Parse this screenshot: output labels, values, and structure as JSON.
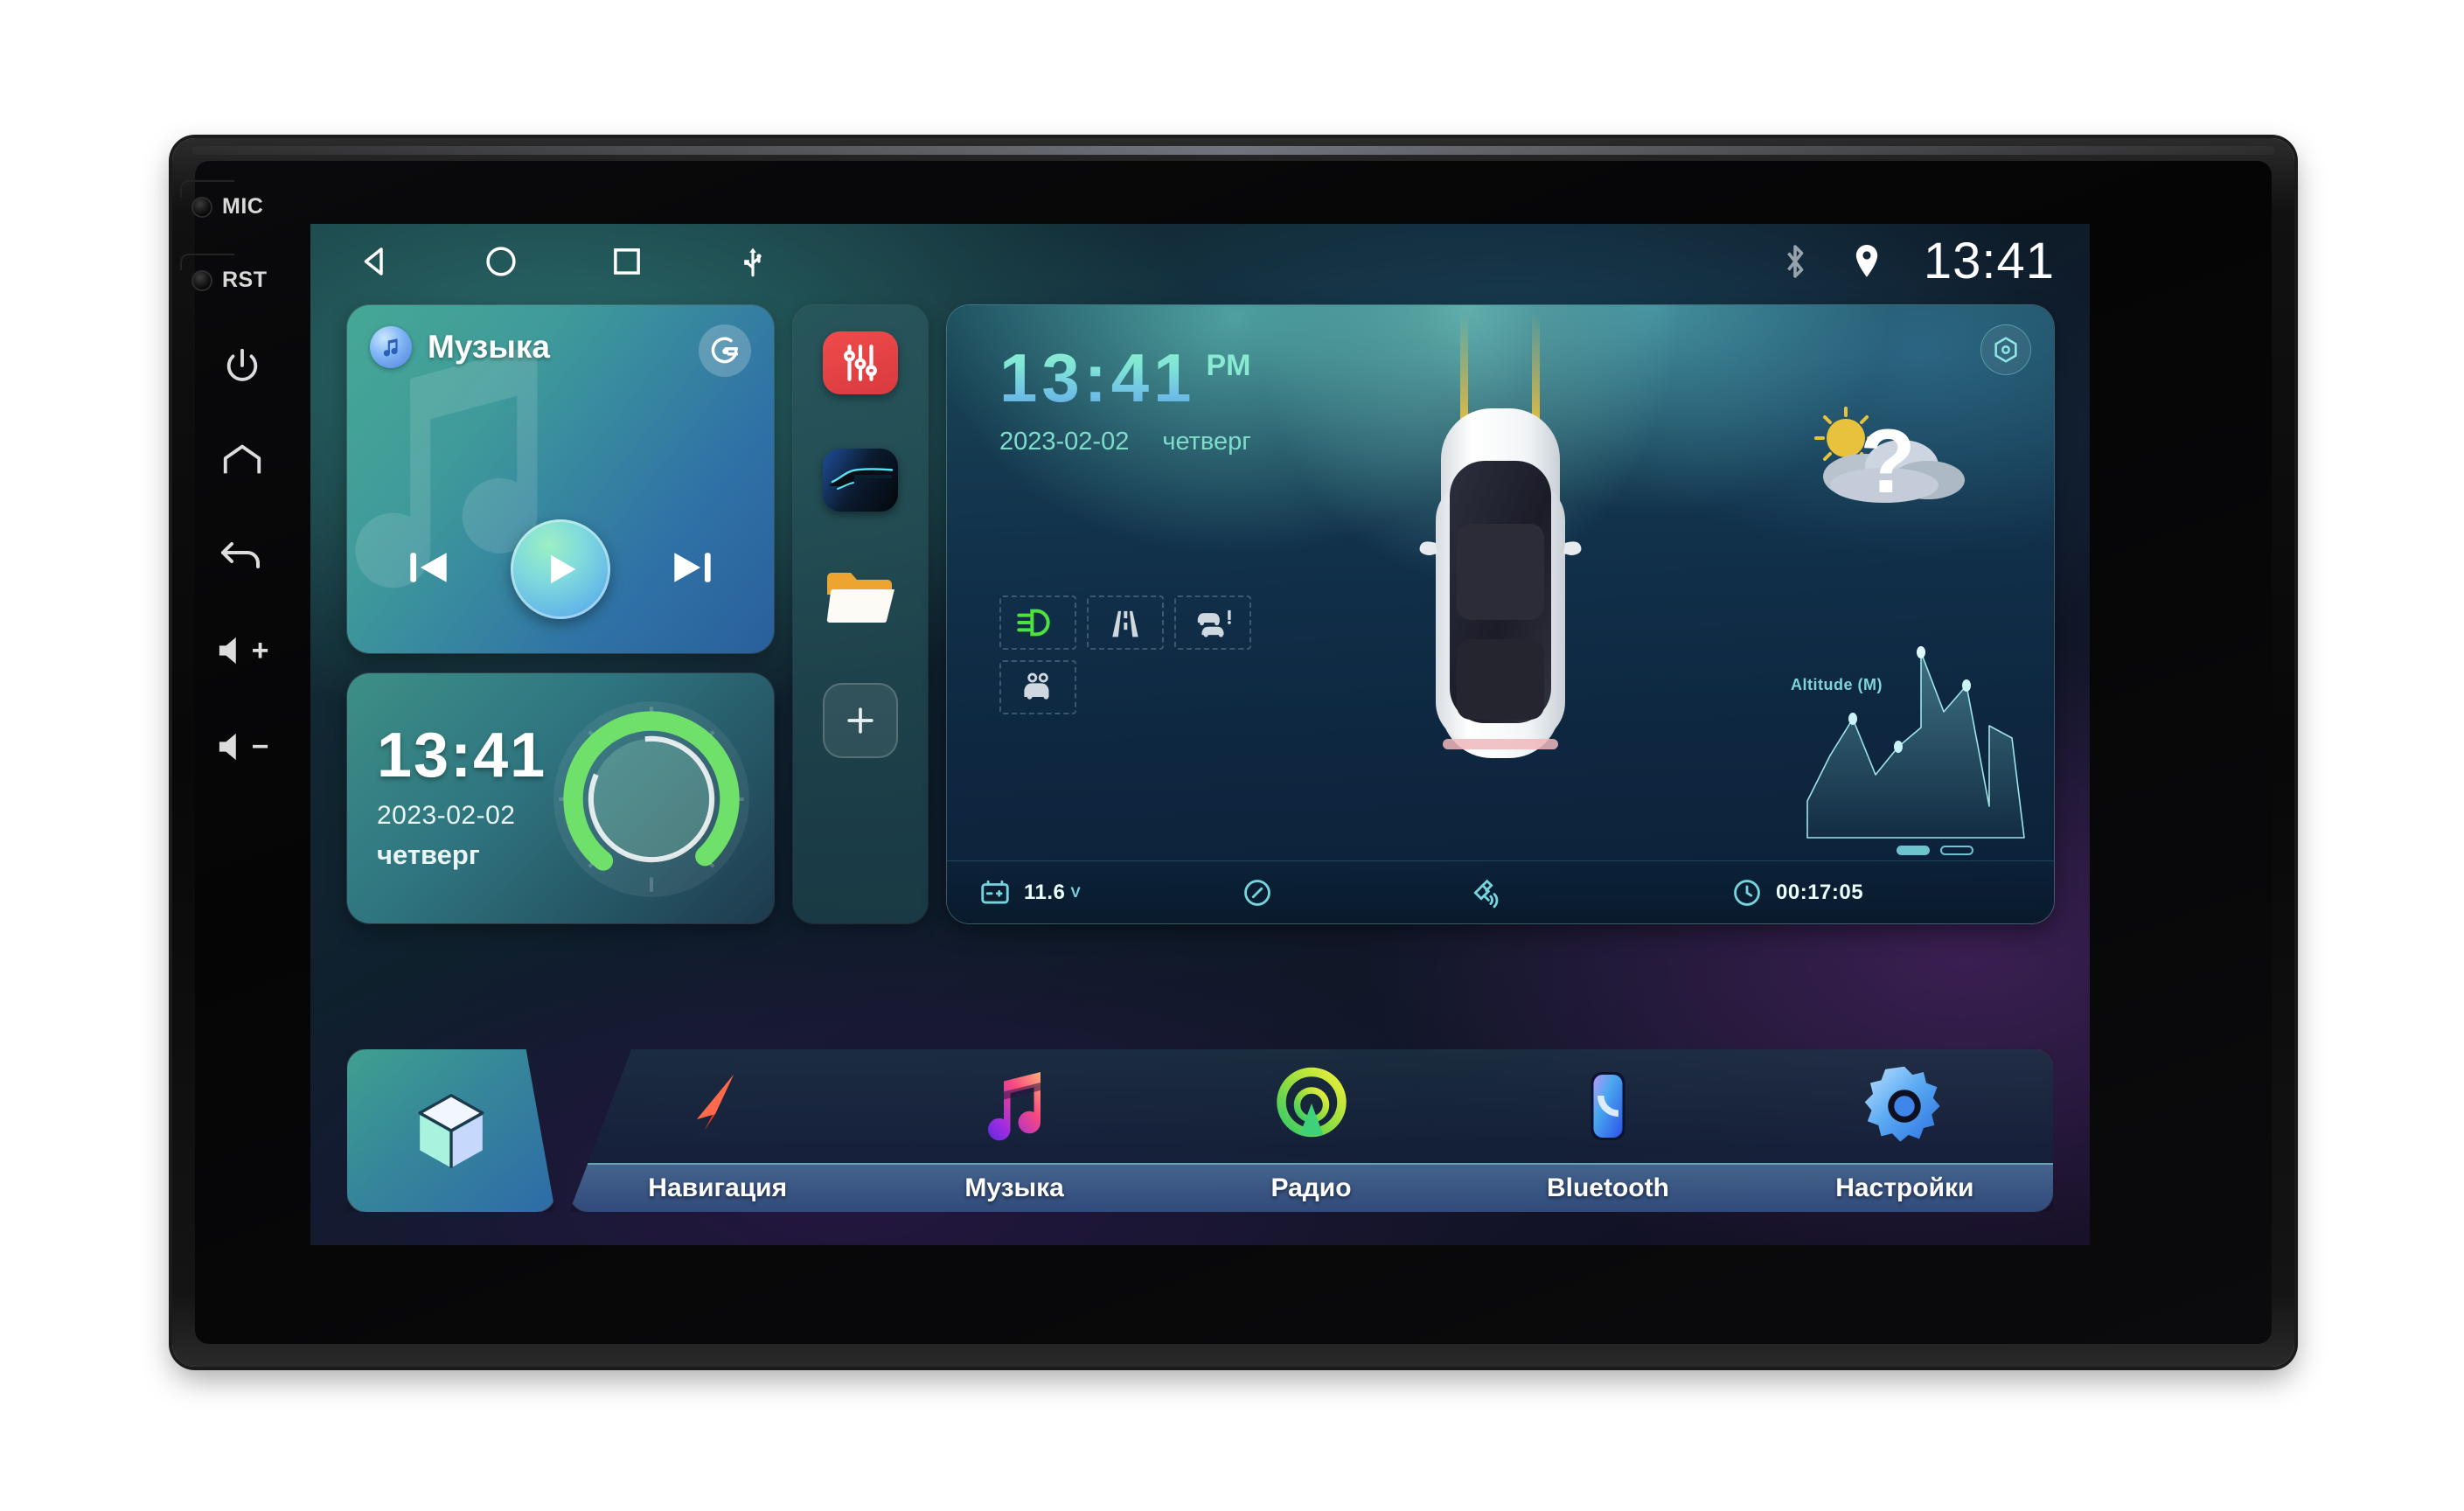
{
  "device": {
    "ports": [
      {
        "label": "MIC",
        "name": "mic-port"
      },
      {
        "label": "RST",
        "name": "reset-port"
      }
    ],
    "buttons": [
      {
        "name": "power-button",
        "icon": "power-icon",
        "label": ""
      },
      {
        "name": "home-button",
        "icon": "home-icon",
        "label": ""
      },
      {
        "name": "back-button",
        "icon": "back-arrow-icon",
        "label": ""
      },
      {
        "name": "volume-up-button",
        "icon": "speaker-plus-icon",
        "label": "+"
      },
      {
        "name": "volume-down-button",
        "icon": "speaker-minus-icon",
        "label": "−"
      }
    ]
  },
  "statusbar": {
    "nav": [
      {
        "name": "android-back-button",
        "icon": "triangle-back-icon"
      },
      {
        "name": "android-home-button",
        "icon": "circle-home-icon"
      },
      {
        "name": "android-recents-button",
        "icon": "square-recents-icon"
      },
      {
        "name": "usb-status-icon",
        "icon": "usb-icon"
      }
    ],
    "bluetooth_icon": "bluetooth-icon",
    "location_icon": "location-pin-icon",
    "time": "13:41"
  },
  "music_widget": {
    "title": "Музыка",
    "app_icon": "music-note-icon",
    "source_icon": "audio-source-icon",
    "prev_icon": "skip-previous-icon",
    "play_icon": "play-icon",
    "next_icon": "skip-next-icon"
  },
  "clock_widget": {
    "time": "13:41",
    "date": "2023-02-02",
    "weekday": "четверг",
    "knob_icon": "volume-knob-icon",
    "knob_value": 72
  },
  "icon_rail": {
    "items": [
      {
        "name": "equalizer-app",
        "icon": "equalizer-icon"
      },
      {
        "name": "dvr-app",
        "icon": "car-dvr-icon"
      },
      {
        "name": "file-manager-app",
        "icon": "folder-icon"
      },
      {
        "name": "add-shortcut-button",
        "icon": "plus-icon"
      }
    ]
  },
  "dashboard": {
    "time": "13:41",
    "ampm": "PM",
    "date": "2023-02-02",
    "weekday": "четверг",
    "settings_icon": "hexagon-settings-icon",
    "weather_icon": "sun-cloud-icon",
    "weather_unknown": "?",
    "car_icon": "car-top-view-icon",
    "adas": [
      {
        "name": "low-beam-indicator",
        "icon": "headlight-icon",
        "active": true
      },
      {
        "name": "lane-assist-indicator",
        "icon": "lane-road-icon",
        "active": false
      },
      {
        "name": "collision-warning-indicator",
        "icon": "car-collision-icon",
        "active": false
      },
      {
        "name": "front-sensor-indicator",
        "icon": "car-front-sensor-icon",
        "active": false
      }
    ],
    "altitude_label": "Altitude (M)",
    "footer": {
      "battery_icon": "battery-icon",
      "voltage_value": "11.6",
      "voltage_unit": "V",
      "compass_icon": "compass-icon",
      "satellite_icon": "satellite-icon",
      "clock_icon": "clock-icon",
      "uptime": "00:17:05"
    }
  },
  "chart_data": {
    "type": "area",
    "title": "Altitude (M)",
    "xlabel": "",
    "ylabel": "Altitude (M)",
    "x": [
      0,
      1,
      2,
      3,
      4,
      5,
      6,
      7,
      8,
      9
    ],
    "values": [
      18,
      62,
      30,
      46,
      96,
      44,
      82,
      10,
      58,
      22
    ],
    "ylim": [
      0,
      100
    ],
    "grid": false,
    "legend": "none",
    "marker_points": [
      {
        "x": 1,
        "y": 62
      },
      {
        "x": 3,
        "y": 46
      },
      {
        "x": 4,
        "y": 96
      },
      {
        "x": 6,
        "y": 82
      }
    ],
    "accent_color": "#7fd4d8"
  },
  "drawer": {
    "name": "app-drawer",
    "icon": "cube-icon"
  },
  "dock": {
    "items": [
      {
        "label": "Навигация",
        "icon": "navigation-arrow-icon",
        "name": "dock-item-navigation"
      },
      {
        "label": "Музыка",
        "icon": "music-note-icon",
        "name": "dock-item-music"
      },
      {
        "label": "Радио",
        "icon": "radio-wave-icon",
        "name": "dock-item-radio"
      },
      {
        "label": "Bluetooth",
        "icon": "phone-bluetooth-icon",
        "name": "dock-item-bluetooth"
      },
      {
        "label": "Настройки",
        "icon": "gear-icon",
        "name": "dock-item-settings"
      }
    ]
  },
  "colors": {
    "accent_teal": "#7fd4d8",
    "accent_green": "#6fe06a",
    "eq_red": "#ef4b4b",
    "play_blue": "#4f9ef0"
  }
}
